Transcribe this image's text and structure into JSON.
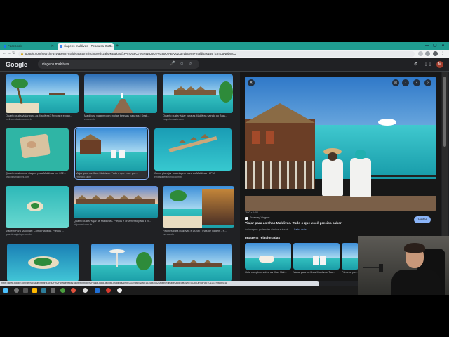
{
  "browser": {
    "tabs": [
      {
        "label": "Facebook",
        "color": "#1877f2"
      },
      {
        "label": "viagens maldivas - Pesquisa Goo...",
        "color": "#4285f4"
      }
    ],
    "new_tab": "+",
    "url": "google.com/search?q=viagens+maldivas&tbm=isch&ved=2ahUKEwjcpafxPAhUG8Q7kGHWaJsQ2-cCegQIABAA&oq=viagens+maldivas&gs_lcp=CgNpbWcQ"
  },
  "google": {
    "logo": "Google",
    "query": "viagens maldivas",
    "avatar_letter": "M"
  },
  "results": [
    {
      "caption": "Quanto custa viajar para as Maldivas? Preços e expan...",
      "source": "melhoresdestinos.com.br"
    },
    {
      "caption": "Maldivas: viagem com muitas belezas naturais | Desti...",
      "source": "cvc.com.br"
    },
    {
      "caption": "Quanto custa viajar para as Maldivas saindo do Bras...",
      "source": "voupelomundo.com"
    },
    {
      "caption": "Quanto custa uma viagem para Maldivas em 202...",
      "source": "lowcostsmaldives.com"
    },
    {
      "caption": "Viajar para as Ilhas Maldivas. Tudo o que você pre...",
      "source": "Freeway.tur.br"
    },
    {
      "caption": "Como planejar sua viagem para as Maldivas | 8PM",
      "source": "embarqueramundo.com.br"
    },
    {
      "caption": "Viagem Para Maldivas: Como Planejar, Preços ...",
      "source": "quandoviajarlogo.com.br"
    },
    {
      "caption": "Quanto custa viajar às Maldivas - Preços e orçamento para a vi...",
      "source": "viajoporai.com.br"
    },
    {
      "caption": "Pacotes para Maldivas e Dubai | Ilhas de viagem - P...",
      "source": "cvc.com.br"
    }
  ],
  "preview": {
    "size": "2560 × 1456",
    "site": "Freeway Viagem",
    "title": "Viajar para as Ilhas Maldivas. Tudo o que você precisa saber",
    "note": "As imagens podem ter direitos autorais.",
    "more": "Saiba mais",
    "visit": "Visitar",
    "related_header": "Imagens relacionadas",
    "related": [
      {
        "caption": "Guia completo sobre as Ilhas Mal..."
      },
      {
        "caption": "Viajar para as Ilhas Maldivas. Tud..."
      },
      {
        "caption": "Primeira pa..."
      }
    ]
  },
  "status_url": "https://www.google.com/url?sa=i&url=https%3A%2F%2Fwww.freeway.tur.br%2Fblog%2Fviajar-para-as-ilhas-maldivas&psig=AOvVaw0&ust=1634581062&source=images&cd=vfe&ved=0CAsQjRxqFwoTCLD1_hb6-BBEA",
  "colors": {
    "accent": "#8ab4f8",
    "tabbar": "#1f9d91",
    "background": "#202124"
  }
}
